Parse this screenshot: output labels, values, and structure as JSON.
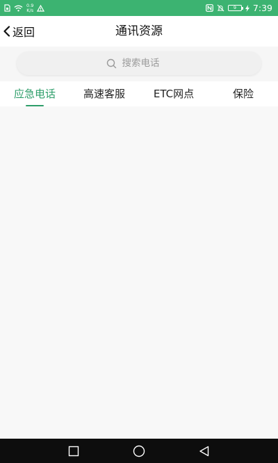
{
  "status_bar": {
    "speed_value": "0.9",
    "speed_unit": "K/s",
    "battery": "9",
    "time": "7:39",
    "background": "#3cb371"
  },
  "navbar": {
    "back_label": "返回",
    "title": "通讯资源"
  },
  "search": {
    "placeholder": "搜索电话"
  },
  "tabs": [
    {
      "label": "应急电话",
      "active": true
    },
    {
      "label": "高速客服",
      "active": false
    },
    {
      "label": "ETC网点",
      "active": false
    },
    {
      "label": "保险",
      "active": false
    }
  ],
  "colors": {
    "accent": "#2e9e6a",
    "statusbar": "#3cb371"
  },
  "icons": {
    "status_left": [
      "sim-icon",
      "wifi-icon",
      "warning-icon"
    ],
    "status_right": [
      "nfc-icon",
      "mute-bell-icon",
      "battery-icon",
      "charging-icon"
    ],
    "system_nav": [
      "recents-icon",
      "home-icon",
      "back-triangle-icon"
    ]
  }
}
